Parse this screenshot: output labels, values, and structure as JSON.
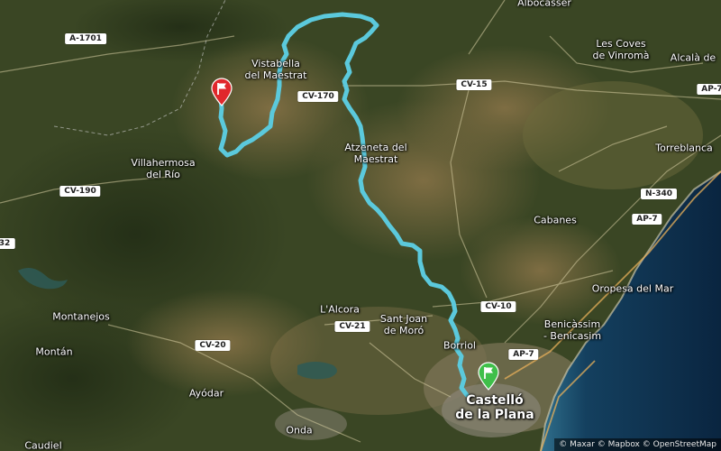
{
  "map": {
    "colors": {
      "land_dark": "#34401f",
      "land_mid": "#5a5a34",
      "land_brown": "#7a6844",
      "sea_deep": "#0b2a45",
      "sea_shallow": "#2f6f8c",
      "route": "#5bc9dc",
      "start_pin": "#3fbf4a",
      "end_pin": "#e0282c"
    },
    "route_label": "route",
    "places": {
      "albocasser": "Albocàsser",
      "vistabella": "Vistabella\ndel Maestrat",
      "les_coves": "Les Coves\nde Vinromà",
      "alcala": "Alcalà de",
      "atzeneta": "Atzeneta del\nMaestrat",
      "villahermosa": "Villahermosa\ndel Río",
      "torreblanca": "Torreblanca",
      "cabanes": "Cabanes",
      "oropesa": "Oropesa del Mar",
      "benicassim": "Benicàssim\n- Benicasim",
      "lalcora": "L'Alcora",
      "sant_joan": "Sant Joan\nde Moró",
      "borriol": "Borriol",
      "castello": "Castelló\nde la Plana",
      "montanejos": "Montanejos",
      "montan": "Montán",
      "ayodar": "Ayódar",
      "onda": "Onda",
      "caudiel": "Caudiel"
    },
    "roads": {
      "a1701": "A-1701",
      "cv170": "CV-170",
      "cv15": "CV-15",
      "ap7_top": "AP-7",
      "n340": "N-340",
      "ap7_mid": "AP-7",
      "cv190": "CV-190",
      "r32": "32",
      "cv10": "CV-10",
      "cv21": "CV-21",
      "cv20": "CV-20",
      "ap7_low": "AP-7"
    },
    "attribution": "© Maxar © Mapbox © OpenStreetMap"
  }
}
